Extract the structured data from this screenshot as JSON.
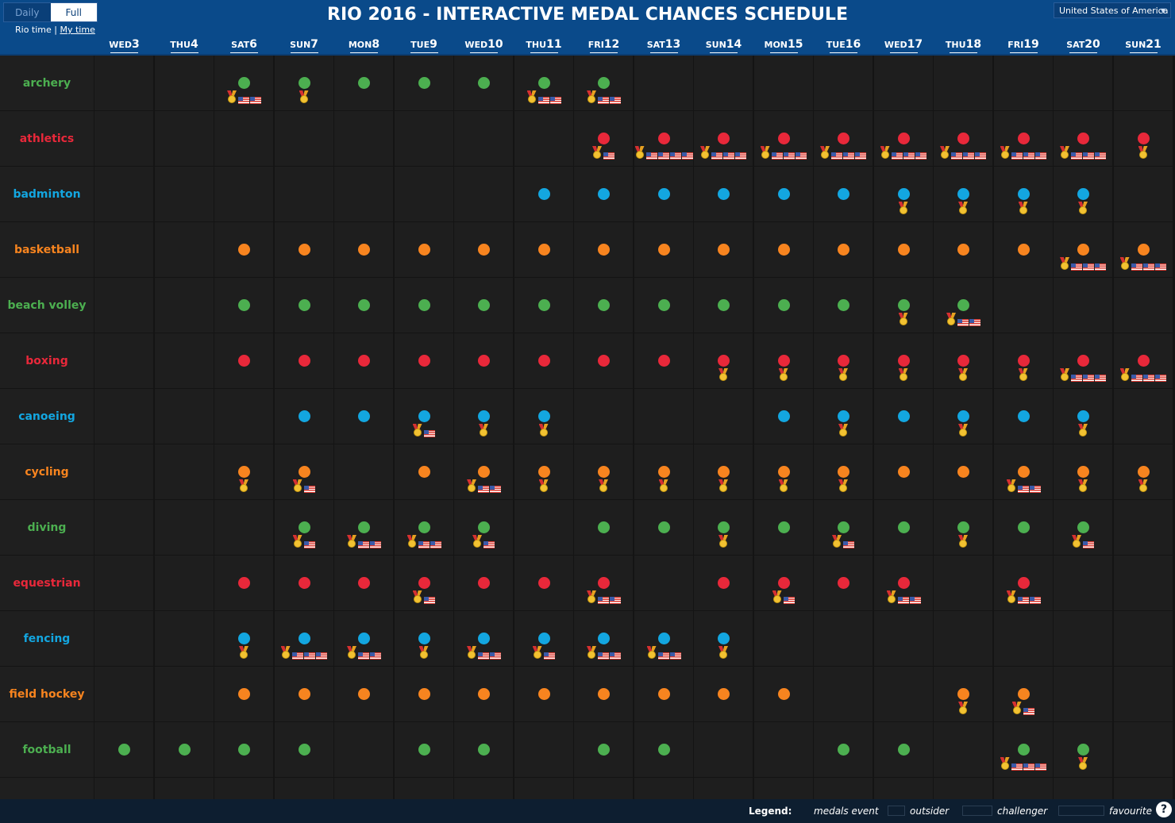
{
  "header": {
    "title": "RIO 2016 - INTERACTIVE MEDAL CHANCES SCHEDULE",
    "toggle": {
      "daily": "Daily",
      "full": "Full"
    },
    "rio_time": "Rio time",
    "separator": "|",
    "my_time": "My time",
    "country": "United States of America"
  },
  "colors": {
    "green": "#4caf50",
    "red": "#e8283a",
    "blue": "#13a6e0",
    "orange": "#f7841f"
  },
  "days": [
    {
      "dow": "WED",
      "num": "3"
    },
    {
      "dow": "THU",
      "num": "4"
    },
    {
      "dow": "SAT",
      "num": "6"
    },
    {
      "dow": "SUN",
      "num": "7"
    },
    {
      "dow": "MON",
      "num": "8"
    },
    {
      "dow": "TUE",
      "num": "9"
    },
    {
      "dow": "WED",
      "num": "10"
    },
    {
      "dow": "THU",
      "num": "11"
    },
    {
      "dow": "FRI",
      "num": "12"
    },
    {
      "dow": "SAT",
      "num": "13"
    },
    {
      "dow": "SUN",
      "num": "14"
    },
    {
      "dow": "MON",
      "num": "15"
    },
    {
      "dow": "TUE",
      "num": "16"
    },
    {
      "dow": "WED",
      "num": "17"
    },
    {
      "dow": "THU",
      "num": "18"
    },
    {
      "dow": "FRI",
      "num": "19"
    },
    {
      "dow": "SAT",
      "num": "20"
    },
    {
      "dow": "SUN",
      "num": "21"
    }
  ],
  "sports": [
    {
      "name": "archery",
      "color": "green",
      "events": [
        0,
        0,
        1,
        1,
        1,
        1,
        1,
        1,
        1,
        0,
        0,
        0,
        0,
        0,
        0,
        0,
        0,
        0
      ],
      "medals": [
        0,
        0,
        1,
        1,
        0,
        0,
        0,
        1,
        1,
        0,
        0,
        0,
        0,
        0,
        0,
        0,
        0,
        0
      ],
      "flags": [
        0,
        0,
        2,
        0,
        0,
        0,
        0,
        2,
        2,
        0,
        0,
        0,
        0,
        0,
        0,
        0,
        0,
        0
      ]
    },
    {
      "name": "athletics",
      "color": "red",
      "events": [
        0,
        0,
        0,
        0,
        0,
        0,
        0,
        0,
        1,
        1,
        1,
        1,
        1,
        1,
        1,
        1,
        1,
        1
      ],
      "medals": [
        0,
        0,
        0,
        0,
        0,
        0,
        0,
        0,
        1,
        1,
        1,
        1,
        1,
        1,
        1,
        1,
        1,
        1
      ],
      "flags": [
        0,
        0,
        0,
        0,
        0,
        0,
        0,
        0,
        1,
        4,
        3,
        3,
        3,
        3,
        3,
        3,
        3,
        0
      ]
    },
    {
      "name": "badminton",
      "color": "blue",
      "events": [
        0,
        0,
        0,
        0,
        0,
        0,
        0,
        1,
        1,
        1,
        1,
        1,
        1,
        1,
        1,
        1,
        1,
        0
      ],
      "medals": [
        0,
        0,
        0,
        0,
        0,
        0,
        0,
        0,
        0,
        0,
        0,
        0,
        0,
        1,
        1,
        1,
        1,
        0
      ],
      "flags": [
        0,
        0,
        0,
        0,
        0,
        0,
        0,
        0,
        0,
        0,
        0,
        0,
        0,
        0,
        0,
        0,
        0,
        0
      ]
    },
    {
      "name": "basketball",
      "color": "orange",
      "events": [
        0,
        0,
        1,
        1,
        1,
        1,
        1,
        1,
        1,
        1,
        1,
        1,
        1,
        1,
        1,
        1,
        1,
        1
      ],
      "medals": [
        0,
        0,
        0,
        0,
        0,
        0,
        0,
        0,
        0,
        0,
        0,
        0,
        0,
        0,
        0,
        0,
        1,
        1
      ],
      "flags": [
        0,
        0,
        0,
        0,
        0,
        0,
        0,
        0,
        0,
        0,
        0,
        0,
        0,
        0,
        0,
        0,
        3,
        3
      ]
    },
    {
      "name": "beach volley",
      "color": "green",
      "events": [
        0,
        0,
        1,
        1,
        1,
        1,
        1,
        1,
        1,
        1,
        1,
        1,
        1,
        1,
        1,
        0,
        0,
        0
      ],
      "medals": [
        0,
        0,
        0,
        0,
        0,
        0,
        0,
        0,
        0,
        0,
        0,
        0,
        0,
        1,
        1,
        0,
        0,
        0
      ],
      "flags": [
        0,
        0,
        0,
        0,
        0,
        0,
        0,
        0,
        0,
        0,
        0,
        0,
        0,
        0,
        2,
        0,
        0,
        0
      ]
    },
    {
      "name": "boxing",
      "color": "red",
      "events": [
        0,
        0,
        1,
        1,
        1,
        1,
        1,
        1,
        1,
        1,
        1,
        1,
        1,
        1,
        1,
        1,
        1,
        1
      ],
      "medals": [
        0,
        0,
        0,
        0,
        0,
        0,
        0,
        0,
        0,
        0,
        1,
        1,
        1,
        1,
        1,
        1,
        1,
        1
      ],
      "flags": [
        0,
        0,
        0,
        0,
        0,
        0,
        0,
        0,
        0,
        0,
        0,
        0,
        0,
        0,
        0,
        0,
        3,
        3
      ]
    },
    {
      "name": "canoeing",
      "color": "blue",
      "events": [
        0,
        0,
        0,
        1,
        1,
        1,
        1,
        1,
        0,
        0,
        0,
        1,
        1,
        1,
        1,
        1,
        1,
        0
      ],
      "medals": [
        0,
        0,
        0,
        0,
        0,
        1,
        1,
        1,
        0,
        0,
        0,
        0,
        1,
        0,
        1,
        0,
        1,
        0
      ],
      "flags": [
        0,
        0,
        0,
        0,
        0,
        1,
        0,
        0,
        0,
        0,
        0,
        0,
        0,
        0,
        0,
        0,
        0,
        0
      ]
    },
    {
      "name": "cycling",
      "color": "orange",
      "events": [
        0,
        0,
        1,
        1,
        0,
        1,
        1,
        1,
        1,
        1,
        1,
        1,
        1,
        1,
        1,
        1,
        1,
        1
      ],
      "medals": [
        0,
        0,
        1,
        1,
        0,
        0,
        1,
        1,
        1,
        1,
        1,
        1,
        1,
        0,
        0,
        1,
        1,
        1
      ],
      "flags": [
        0,
        0,
        0,
        1,
        0,
        0,
        2,
        0,
        0,
        0,
        0,
        0,
        0,
        0,
        0,
        2,
        0,
        0
      ]
    },
    {
      "name": "diving",
      "color": "green",
      "events": [
        0,
        0,
        0,
        1,
        1,
        1,
        1,
        0,
        1,
        1,
        1,
        1,
        1,
        1,
        1,
        1,
        1,
        0
      ],
      "medals": [
        0,
        0,
        0,
        1,
        1,
        1,
        1,
        0,
        0,
        0,
        1,
        0,
        1,
        0,
        1,
        0,
        1,
        0
      ],
      "flags": [
        0,
        0,
        0,
        1,
        2,
        2,
        1,
        0,
        0,
        0,
        0,
        0,
        1,
        0,
        0,
        0,
        1,
        0
      ]
    },
    {
      "name": "equestrian",
      "color": "red",
      "events": [
        0,
        0,
        1,
        1,
        1,
        1,
        1,
        1,
        1,
        0,
        1,
        1,
        1,
        1,
        0,
        1,
        0,
        0
      ],
      "medals": [
        0,
        0,
        0,
        0,
        0,
        1,
        0,
        0,
        1,
        0,
        0,
        1,
        0,
        1,
        0,
        1,
        0,
        0
      ],
      "flags": [
        0,
        0,
        0,
        0,
        0,
        1,
        0,
        0,
        2,
        0,
        0,
        1,
        0,
        2,
        0,
        2,
        0,
        0
      ]
    },
    {
      "name": "fencing",
      "color": "blue",
      "events": [
        0,
        0,
        1,
        1,
        1,
        1,
        1,
        1,
        1,
        1,
        1,
        0,
        0,
        0,
        0,
        0,
        0,
        0
      ],
      "medals": [
        0,
        0,
        1,
        1,
        1,
        1,
        1,
        1,
        1,
        1,
        1,
        0,
        0,
        0,
        0,
        0,
        0,
        0
      ],
      "flags": [
        0,
        0,
        0,
        3,
        2,
        0,
        2,
        1,
        2,
        2,
        0,
        0,
        0,
        0,
        0,
        0,
        0,
        0
      ]
    },
    {
      "name": "field hockey",
      "color": "orange",
      "events": [
        0,
        0,
        1,
        1,
        1,
        1,
        1,
        1,
        1,
        1,
        1,
        1,
        0,
        0,
        1,
        1,
        0,
        0
      ],
      "medals": [
        0,
        0,
        0,
        0,
        0,
        0,
        0,
        0,
        0,
        0,
        0,
        0,
        0,
        0,
        1,
        1,
        0,
        0
      ],
      "flags": [
        0,
        0,
        0,
        0,
        0,
        0,
        0,
        0,
        0,
        0,
        0,
        0,
        0,
        0,
        0,
        1,
        0,
        0
      ]
    },
    {
      "name": "football",
      "color": "green",
      "events": [
        1,
        1,
        1,
        1,
        0,
        1,
        1,
        0,
        1,
        1,
        0,
        0,
        1,
        1,
        0,
        1,
        1,
        0
      ],
      "medals": [
        0,
        0,
        0,
        0,
        0,
        0,
        0,
        0,
        0,
        0,
        0,
        0,
        0,
        0,
        0,
        1,
        1,
        0
      ],
      "flags": [
        0,
        0,
        0,
        0,
        0,
        0,
        0,
        0,
        0,
        0,
        0,
        0,
        0,
        0,
        0,
        3,
        0,
        0
      ]
    }
  ],
  "legend": {
    "label": "Legend:",
    "medals_event": "medals event",
    "outsider": "outsider",
    "challenger": "challenger",
    "favourite": "favourite",
    "help": "?"
  }
}
